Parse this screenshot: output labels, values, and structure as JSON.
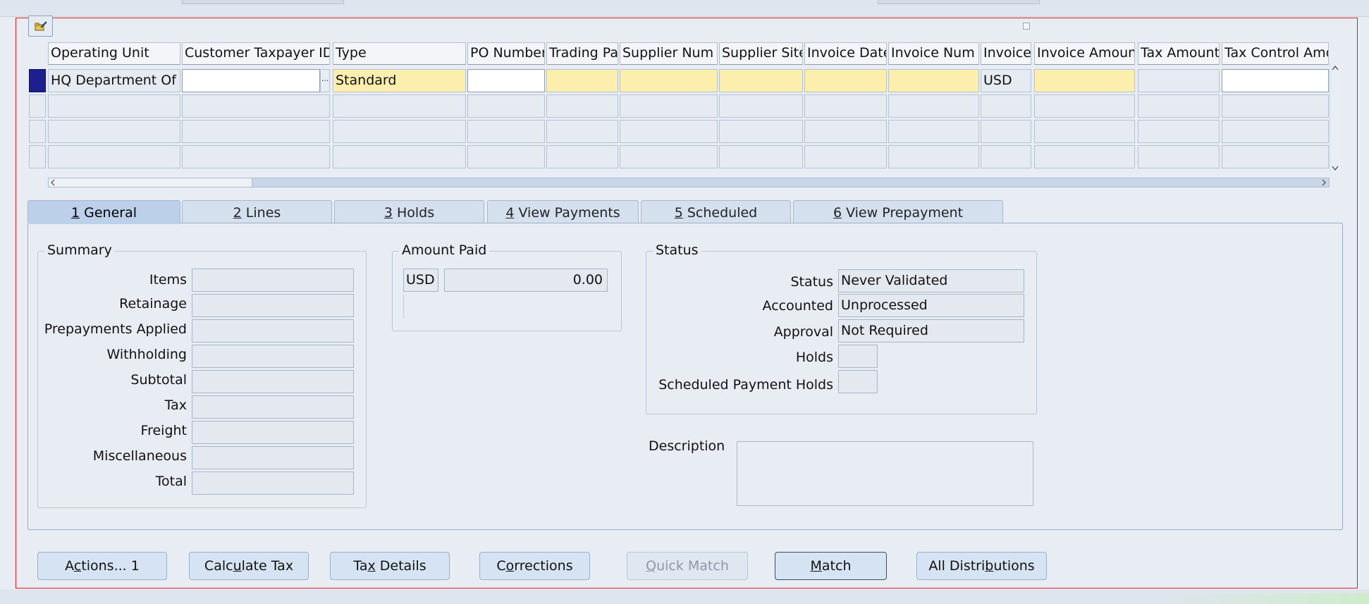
{
  "grid": {
    "columns": [
      {
        "key": "operating_unit",
        "label": "Operating Unit"
      },
      {
        "key": "customer_taxpayer_id",
        "label": "Customer Taxpayer ID"
      },
      {
        "key": "type",
        "label": "Type"
      },
      {
        "key": "po_number",
        "label": "PO Number"
      },
      {
        "key": "trading_partner",
        "label": "Trading Pa"
      },
      {
        "key": "supplier_num",
        "label": "Supplier Num"
      },
      {
        "key": "supplier_site",
        "label": "Supplier Site"
      },
      {
        "key": "invoice_date",
        "label": "Invoice Date"
      },
      {
        "key": "invoice_num",
        "label": "Invoice Num"
      },
      {
        "key": "invoice_currency",
        "label": "Invoice"
      },
      {
        "key": "invoice_amount",
        "label": "Invoice Amount"
      },
      {
        "key": "tax_amount",
        "label": "Tax Amount"
      },
      {
        "key": "tax_control_amount",
        "label": "Tax Control Amou"
      }
    ],
    "row1": {
      "operating_unit": "HQ Department Of L",
      "customer_taxpayer_id": "",
      "type": "Standard",
      "po_number": "",
      "trading_partner": "",
      "supplier_num": "",
      "supplier_site": "",
      "invoice_date": "",
      "invoice_num": "",
      "invoice_currency": "USD",
      "invoice_amount": "",
      "tax_amount": "",
      "tax_control_amount": ""
    },
    "lov_glyph": "...",
    "empty_row_count": 3
  },
  "tabs": [
    {
      "num": "1",
      "label": " General",
      "active": true
    },
    {
      "num": "2",
      "label": " Lines",
      "active": false
    },
    {
      "num": "3",
      "label": " Holds",
      "active": false
    },
    {
      "num": "4",
      "label": " View Payments",
      "active": false
    },
    {
      "num": "5",
      "label": " Scheduled Payments",
      "active": false
    },
    {
      "num": "6",
      "label": " View Prepayment Applications",
      "active": false
    }
  ],
  "summary": {
    "title": "Summary",
    "fields": [
      "Items",
      "Retainage",
      "Prepayments Applied",
      "Withholding",
      "Subtotal",
      "Tax",
      "Freight",
      "Miscellaneous",
      "Total"
    ]
  },
  "amount_paid": {
    "title": "Amount Paid",
    "currency": "USD",
    "amount": "0.00"
  },
  "status_group": {
    "title": "Status",
    "status_label": "Status",
    "status_value": "Never Validated",
    "accounted_label": "Accounted",
    "accounted_value": "Unprocessed",
    "approval_label": "Approval",
    "approval_value": "Not Required",
    "holds_label": "Holds",
    "holds_value": "",
    "scheduled_holds_label": "Scheduled Payment Holds",
    "scheduled_holds_value": ""
  },
  "description": {
    "label": "Description",
    "value": ""
  },
  "buttons": {
    "actions": {
      "pre": "A",
      "ul": "c",
      "post": "tions... 1"
    },
    "calculate_tax": {
      "pre": "Calc",
      "ul": "u",
      "post": "late Tax"
    },
    "tax_details": {
      "pre": "Ta",
      "ul": "x",
      "post": " Details"
    },
    "corrections": {
      "pre": "C",
      "ul": "o",
      "post": "rrections"
    },
    "quick_match": {
      "pre": "",
      "ul": "Q",
      "post": "uick Match"
    },
    "match": {
      "pre": "",
      "ul": "M",
      "post": "atch"
    },
    "all_distributions": {
      "pre": "All Distri",
      "ul": "b",
      "post": "utions"
    }
  },
  "colors": {
    "required_field": "#fcefae",
    "frame_border": "#e02020",
    "active_row_indicator": "#1d1f8c",
    "active_tab": "#bcd0ea"
  }
}
